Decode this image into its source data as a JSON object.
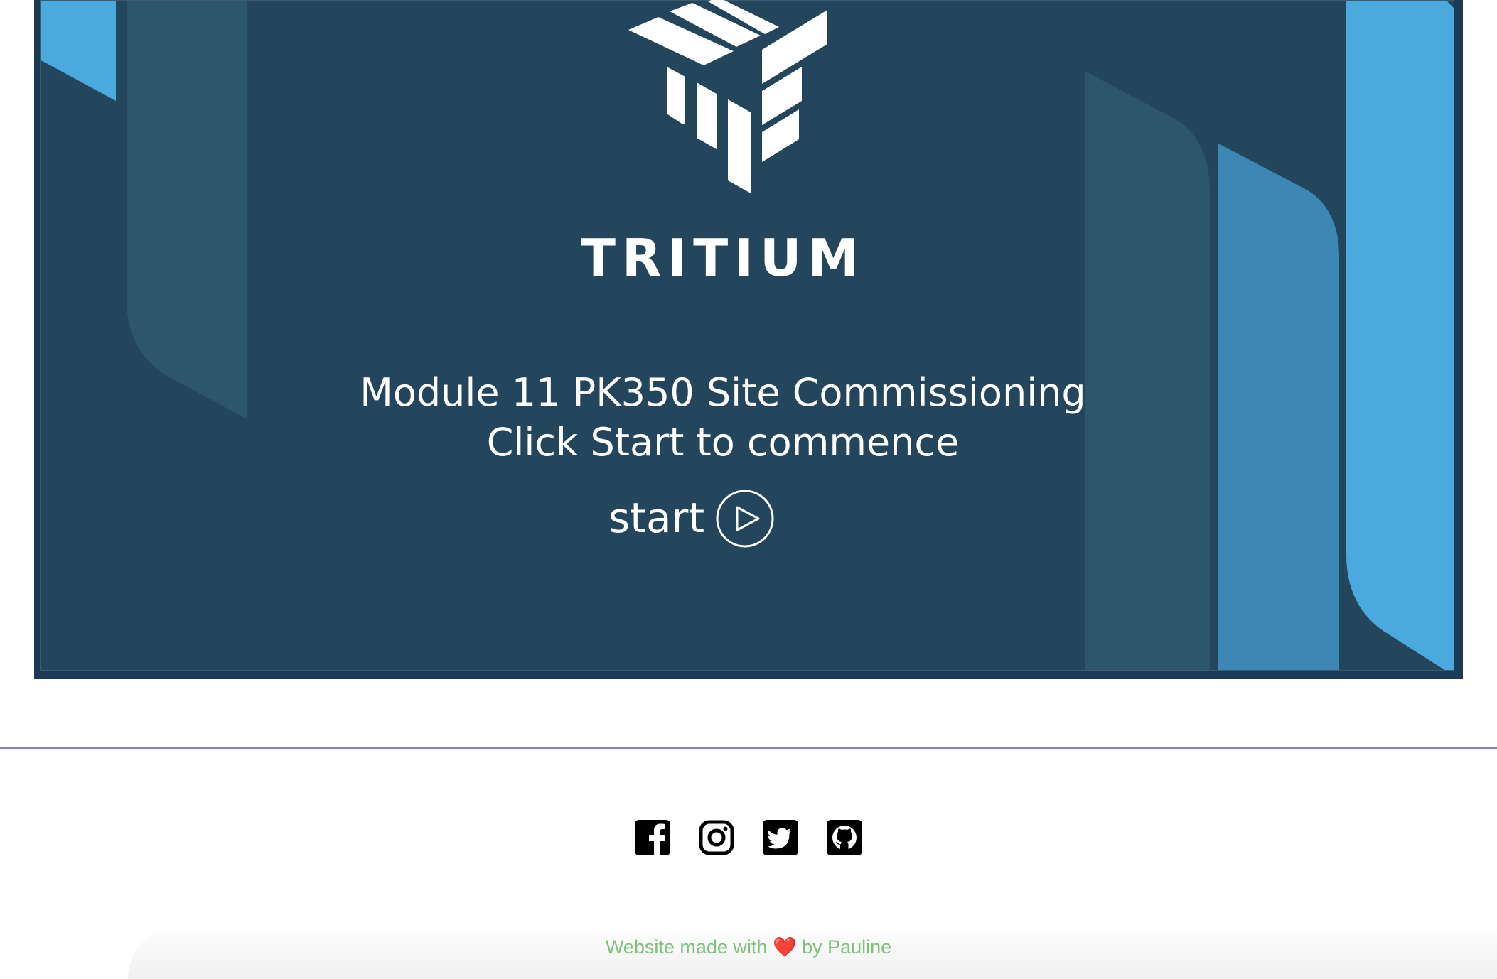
{
  "slide": {
    "brand": "TRITIUM",
    "title_line1": "Module 11 PK350 Site Commissioning",
    "title_line2": "Click Start to commence",
    "start_label": "start",
    "start_icon": "play-circle-icon",
    "colors": {
      "background": "#24465d",
      "frame": "#1c3a56",
      "accent_light_blue": "#4aaade",
      "accent_mid_blue": "#3d87b4",
      "accent_muted": "#2d566b"
    }
  },
  "footer": {
    "social": [
      {
        "name": "facebook",
        "icon": "facebook-icon"
      },
      {
        "name": "instagram",
        "icon": "instagram-icon"
      },
      {
        "name": "twitter",
        "icon": "twitter-icon"
      },
      {
        "name": "github",
        "icon": "github-icon"
      }
    ],
    "credit_prefix": "Website made with",
    "credit_heart": "❤️",
    "credit_suffix": "by Pauline",
    "colors": {
      "divider": "#7f7fd0",
      "credit_text": "#7cc27a"
    }
  }
}
